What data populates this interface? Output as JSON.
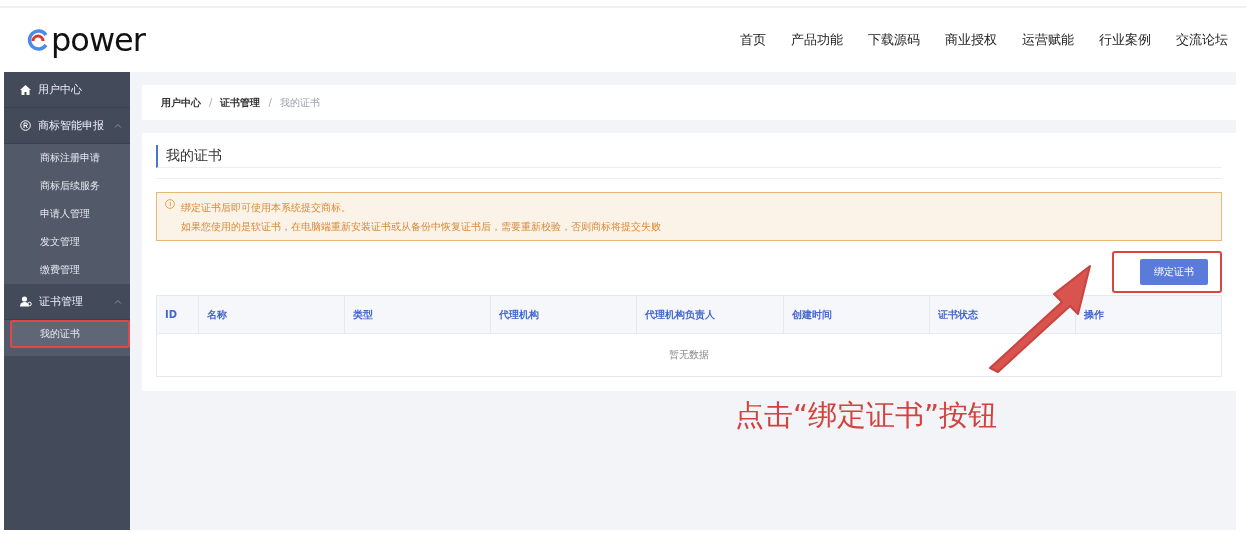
{
  "header": {
    "logo": "power",
    "nav": [
      {
        "label": "首页"
      },
      {
        "label": "产品功能"
      },
      {
        "label": "下载源码"
      },
      {
        "label": "商业授权"
      },
      {
        "label": "运营赋能"
      },
      {
        "label": "行业案例"
      },
      {
        "label": "交流论坛"
      }
    ]
  },
  "sidebar": {
    "items": [
      {
        "label": "用户中心"
      },
      {
        "label": "商标智能申报",
        "expanded": true,
        "children": [
          {
            "label": "商标注册申请",
            "selected": false
          },
          {
            "label": "商标后续服务",
            "selected": false
          },
          {
            "label": "申请人管理",
            "selected": false
          },
          {
            "label": "发文管理",
            "selected": false
          },
          {
            "label": "缴费管理",
            "selected": false
          }
        ]
      },
      {
        "label": "证书管理",
        "expanded": true,
        "children": [
          {
            "label": "我的证书",
            "selected": true,
            "highlighted": true
          }
        ]
      }
    ]
  },
  "breadcrumb": [
    {
      "label": "用户中心",
      "current": false
    },
    {
      "label": "证书管理",
      "current": false
    },
    {
      "label": "我的证书",
      "current": true
    }
  ],
  "breadcrumb_separator": "/",
  "page_title": "我的证书",
  "alert": {
    "lines": [
      "绑定证书后即可使用本系统提交商标。",
      "如果您使用的是软证书，在电脑端重新安装证书或从备份中恢复证书后，需要重新校验，否则商标将提交失败"
    ]
  },
  "bind_button": {
    "label": "绑定证书",
    "highlighted": true
  },
  "table": {
    "columns": [
      "ID",
      "名称",
      "类型",
      "代理机构",
      "代理机构负责人",
      "创建时间",
      "证书状态",
      "操作"
    ],
    "empty_text": "暂无数据"
  },
  "annotation": {
    "text": "点击“绑定证书”按钮"
  }
}
